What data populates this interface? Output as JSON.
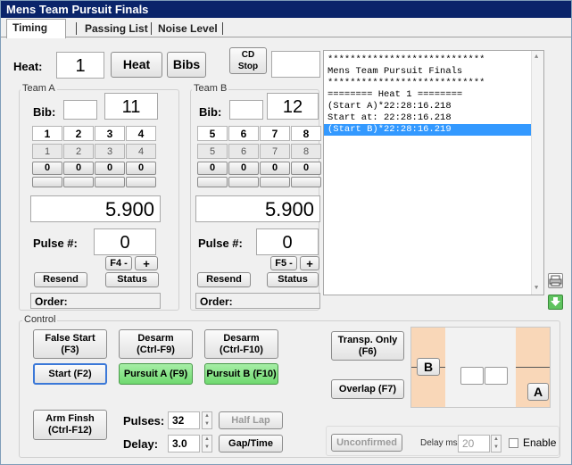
{
  "window": {
    "title": "Mens Team Pursuit Finals"
  },
  "tabs": [
    {
      "label": "Timing"
    },
    {
      "label": "Passing List"
    },
    {
      "label": "Noise Level"
    }
  ],
  "heat": {
    "label": "Heat:",
    "value": "1",
    "heat_button": "Heat",
    "bibs_button": "Bibs",
    "cd_stop_button": "CD\nStop",
    "cd_value": ""
  },
  "team_a": {
    "group_label": "Team A",
    "bib_label": "Bib:",
    "bib_small": "",
    "bib_value": "11",
    "riders": [
      "1",
      "2",
      "3",
      "4"
    ],
    "riders_grey": [
      "1",
      "2",
      "3",
      "4"
    ],
    "counts": [
      "0",
      "0",
      "0",
      "0"
    ],
    "time": "5.900",
    "pulse_label": "Pulse #:",
    "pulse_value": "0",
    "fkey_button": "F4 -",
    "plus_button": "+",
    "resend_button": "Resend",
    "status_button": "Status",
    "order_label": "Order:"
  },
  "team_b": {
    "group_label": "Team B",
    "bib_label": "Bib:",
    "bib_small": "",
    "bib_value": "12",
    "riders": [
      "5",
      "6",
      "7",
      "8"
    ],
    "riders_grey": [
      "5",
      "6",
      "7",
      "8"
    ],
    "counts": [
      "0",
      "0",
      "0",
      "0"
    ],
    "time": "5.900",
    "pulse_label": "Pulse #:",
    "pulse_value": "0",
    "fkey_button": "F5 -",
    "plus_button": "+",
    "resend_button": "Resend",
    "status_button": "Status",
    "order_label": "Order:"
  },
  "log": {
    "lines": [
      "****************************",
      "Mens Team Pursuit Finals",
      "****************************",
      "======== Heat 1 ========",
      "(Start A)*22:28:16.218",
      "Start at: 22:28:16.218",
      "(Start B)*22:28:16.219"
    ],
    "selected_index": 6
  },
  "control": {
    "group_label": "Control",
    "false_start": "False Start\n(F3)",
    "desarm_a": "Desarm\n(Ctrl-F9)",
    "desarm_b": "Desarm\n(Ctrl-F10)",
    "start": "Start (F2)",
    "pursuit_a": "Pursuit A (F9)",
    "pursuit_b": "Pursuit B (F10)",
    "arm_finish": "Arm Finsh\n(Ctrl-F12)",
    "pulses_label": "Pulses:",
    "pulses_value": "32",
    "half_lap": "Half Lap",
    "delay_label": "Delay:",
    "delay_value": "3.0",
    "gap_time": "Gap/Time",
    "transp_only": "Transp. Only\n(F6)",
    "overlap": "Overlap (F7)",
    "track_b": "B",
    "track_a": "A",
    "unconfirmed": "Unconfirmed",
    "delay_ms_label": "Delay ms",
    "delay_ms_value": "20",
    "enable_label": "Enable"
  },
  "colors": {
    "titlebar": "#0a246a",
    "green_button": "#7ddf7d",
    "track_orange": "#f9d7b8",
    "selection": "#3399ff"
  }
}
